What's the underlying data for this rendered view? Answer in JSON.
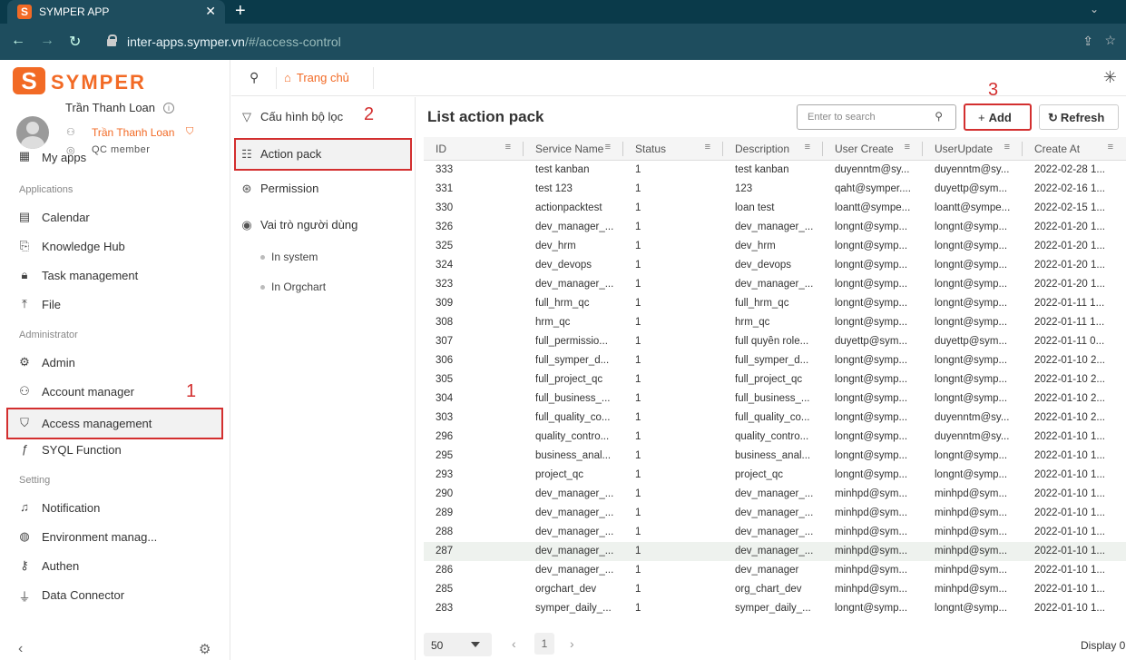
{
  "browser": {
    "tab_title": "SYMPER APP",
    "url_host": "inter-apps.symper.vn",
    "url_path": "/#/access-control"
  },
  "sidebar": {
    "brand": "SYMPER",
    "user_name": "Trần Thanh Loan",
    "user_display": "Trần Thanh Loan",
    "user_role": "QC member",
    "my_apps": "My apps",
    "sections": [
      "Applications",
      "Administrator",
      "Setting"
    ],
    "applications": [
      "Calendar",
      "Knowledge Hub",
      "Task management",
      "File"
    ],
    "administrator": [
      "Admin",
      "Account manager",
      "Access management",
      "SYQL Function"
    ],
    "setting": [
      "Notification",
      "Environment manag...",
      "Authen",
      "Data Connector"
    ]
  },
  "topbar": {
    "home": "Trang chủ"
  },
  "subnav": {
    "items": [
      "Cấu hình bộ lọc",
      "Action pack",
      "Permission",
      "Vai trò người dùng"
    ],
    "subitems": [
      "In system",
      "In Orgchart"
    ]
  },
  "annotations": [
    "1",
    "2",
    "3"
  ],
  "main": {
    "title": "List action pack",
    "search_placeholder": "Enter to search",
    "add_label": "Add",
    "refresh_label": "Refresh",
    "columns": [
      "ID",
      "Service Name",
      "Status",
      "Description",
      "User Create",
      "UserUpdate",
      "Create At"
    ],
    "rows": [
      [
        "333",
        "test kanban",
        "1",
        "test kanban",
        "duyenntm@sy...",
        "duyenntm@sy...",
        "2022-02-28 1..."
      ],
      [
        "331",
        "test 123",
        "1",
        "123",
        "qaht@symper....",
        "duyettp@sym...",
        "2022-02-16 1..."
      ],
      [
        "330",
        "actionpacktest",
        "1",
        "loan test",
        "loantt@sympe...",
        "loantt@sympe...",
        "2022-02-15 1..."
      ],
      [
        "326",
        "dev_manager_...",
        "1",
        "dev_manager_...",
        "longnt@symp...",
        "longnt@symp...",
        "2022-01-20 1..."
      ],
      [
        "325",
        "dev_hrm",
        "1",
        "dev_hrm",
        "longnt@symp...",
        "longnt@symp...",
        "2022-01-20 1..."
      ],
      [
        "324",
        "dev_devops",
        "1",
        "dev_devops",
        "longnt@symp...",
        "longnt@symp...",
        "2022-01-20 1..."
      ],
      [
        "323",
        "dev_manager_...",
        "1",
        "dev_manager_...",
        "longnt@symp...",
        "longnt@symp...",
        "2022-01-20 1..."
      ],
      [
        "309",
        "full_hrm_qc",
        "1",
        "full_hrm_qc",
        "longnt@symp...",
        "longnt@symp...",
        "2022-01-11 1..."
      ],
      [
        "308",
        "hrm_qc",
        "1",
        "hrm_qc",
        "longnt@symp...",
        "longnt@symp...",
        "2022-01-11 1..."
      ],
      [
        "307",
        "full_permissio...",
        "1",
        "full quyền role...",
        "duyettp@sym...",
        "duyettp@sym...",
        "2022-01-11 0..."
      ],
      [
        "306",
        "full_symper_d...",
        "1",
        "full_symper_d...",
        "longnt@symp...",
        "longnt@symp...",
        "2022-01-10 2..."
      ],
      [
        "305",
        "full_project_qc",
        "1",
        "full_project_qc",
        "longnt@symp...",
        "longnt@symp...",
        "2022-01-10 2..."
      ],
      [
        "304",
        "full_business_...",
        "1",
        "full_business_...",
        "longnt@symp...",
        "longnt@symp...",
        "2022-01-10 2..."
      ],
      [
        "303",
        "full_quality_co...",
        "1",
        "full_quality_co...",
        "longnt@symp...",
        "duyenntm@sy...",
        "2022-01-10 2..."
      ],
      [
        "296",
        "quality_contro...",
        "1",
        "quality_contro...",
        "longnt@symp...",
        "duyenntm@sy...",
        "2022-01-10 1..."
      ],
      [
        "295",
        "business_anal...",
        "1",
        "business_anal...",
        "longnt@symp...",
        "longnt@symp...",
        "2022-01-10 1..."
      ],
      [
        "293",
        "project_qc",
        "1",
        "project_qc",
        "longnt@symp...",
        "longnt@symp...",
        "2022-01-10 1..."
      ],
      [
        "290",
        "dev_manager_...",
        "1",
        "dev_manager_...",
        "minhpd@sym...",
        "minhpd@sym...",
        "2022-01-10 1..."
      ],
      [
        "289",
        "dev_manager_...",
        "1",
        "dev_manager_...",
        "minhpd@sym...",
        "minhpd@sym...",
        "2022-01-10 1..."
      ],
      [
        "288",
        "dev_manager_...",
        "1",
        "dev_manager_...",
        "minhpd@sym...",
        "minhpd@sym...",
        "2022-01-10 1..."
      ],
      [
        "287",
        "dev_manager_...",
        "1",
        "dev_manager_...",
        "minhpd@sym...",
        "minhpd@sym...",
        "2022-01-10 1..."
      ],
      [
        "286",
        "dev_manager_...",
        "1",
        "dev_manager",
        "minhpd@sym...",
        "minhpd@sym...",
        "2022-01-10 1..."
      ],
      [
        "285",
        "orgchart_dev",
        "1",
        "org_chart_dev",
        "minhpd@sym...",
        "minhpd@sym...",
        "2022-01-10 1..."
      ],
      [
        "283",
        "symper_daily_...",
        "1",
        "symper_daily_...",
        "longnt@symp...",
        "longnt@symp...",
        "2022-01-10 1..."
      ]
    ],
    "selected_row": 20,
    "page_size": "50",
    "page": "1",
    "display_text": "Display 0"
  }
}
